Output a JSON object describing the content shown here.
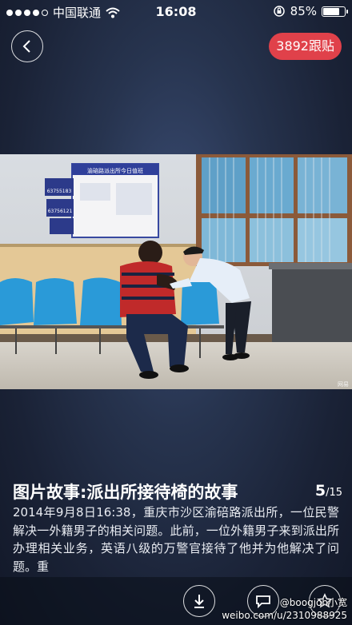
{
  "status_bar": {
    "carrier": "中国联通",
    "time": "16:08",
    "battery_percent": "85%",
    "battery_level": 0.85,
    "signal_dots_filled": 4,
    "signal_dots_total": 5
  },
  "header": {
    "back_icon": "chevron-left-icon",
    "follow_label": "3892跟贴",
    "follow_color": "#e0414a"
  },
  "photo": {
    "poster_title": "渝碚路派出所今日值班",
    "phone_1": "63755183",
    "phone_2": "63756121",
    "signature": "网易"
  },
  "caption": {
    "title": "图片故事:派出所接待椅的故事",
    "current_page": "5",
    "total_pages": "/15",
    "body": "2014年9月8日16:38，重庆市沙区渝碚路派出所，一位民警解决一外籍男子的相关问题。此前，一位外籍男子来到派出所办理相关业务，英语八级的万警官接待了他并为他解决了问题。重"
  },
  "toolbar": {
    "download_icon": "download-icon",
    "comment_icon": "comment-icon",
    "star_icon": "star-icon"
  },
  "watermark": {
    "line1": "@boogjoh小宽",
    "line2": "weibo.com/u/2310988925"
  }
}
